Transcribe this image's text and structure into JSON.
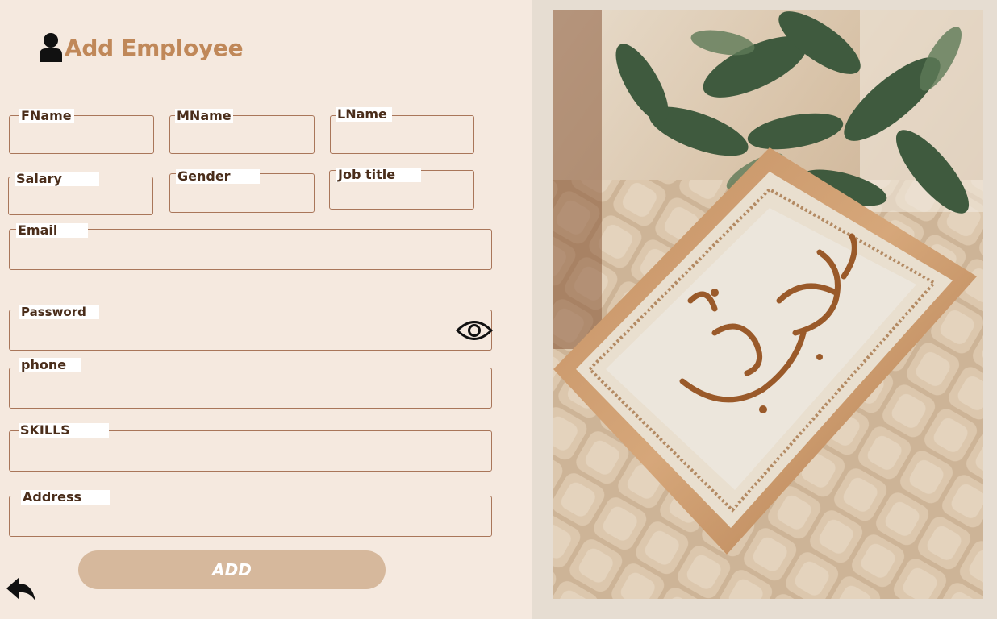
{
  "header": {
    "title": "Add Employee",
    "icon": "user-icon"
  },
  "fields": {
    "fname": {
      "label": "FName",
      "value": ""
    },
    "mname": {
      "label": "MName",
      "value": ""
    },
    "lname": {
      "label": "LName",
      "value": ""
    },
    "salary": {
      "label": "Salary",
      "value": ""
    },
    "gender": {
      "label": "Gender",
      "value": ""
    },
    "job_title": {
      "label": "Job title",
      "value": ""
    },
    "email": {
      "label": "Email",
      "value": ""
    },
    "password": {
      "label": "Password",
      "value": ""
    },
    "phone": {
      "label": "phone",
      "value": ""
    },
    "skills": {
      "label": "SKILLS",
      "value": ""
    },
    "address": {
      "label": "Address",
      "value": ""
    }
  },
  "actions": {
    "add_label": "ADD",
    "back_icon": "back-arrow-icon",
    "toggle_icon": "eye-icon"
  },
  "image": {
    "subject": "framed-calligraphy-photo"
  },
  "colors": {
    "accent": "#c08859",
    "border": "#a9765a",
    "button": "#d6b89c",
    "background": "#f5e9df"
  }
}
